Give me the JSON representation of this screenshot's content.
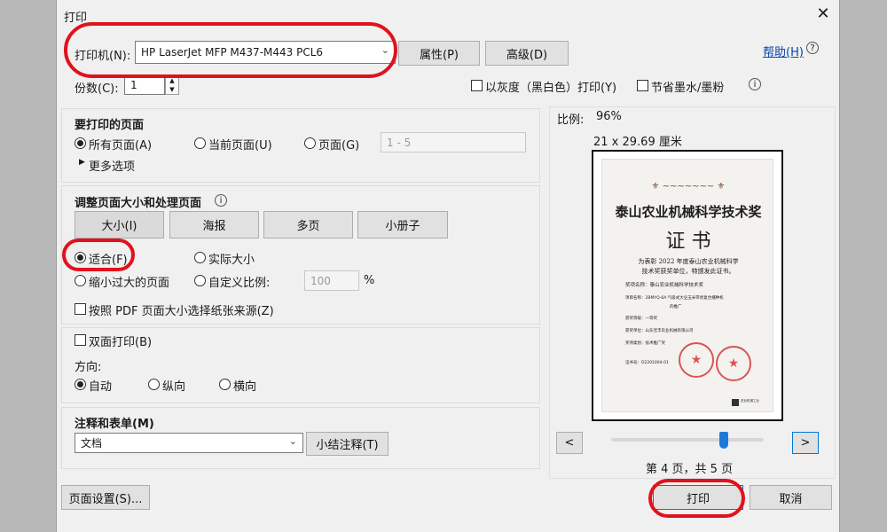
{
  "window": {
    "title": "打印"
  },
  "printer": {
    "label": "打印机(N):",
    "selected": "HP LaserJet MFP M437-M443 PCL6",
    "properties": "属性(P)",
    "advanced": "高级(D)"
  },
  "help": {
    "link": "帮助(H)"
  },
  "copies": {
    "label": "份数(C):",
    "value": "1"
  },
  "options": {
    "grayscale": "以灰度（黑白色）打印(Y)",
    "save_ink": "节省墨水/墨粉"
  },
  "pages_to_print": {
    "heading": "要打印的页面",
    "all": "所有页面(A)",
    "current": "当前页面(U)",
    "pages": "页面(G)",
    "range": "1 - 5",
    "more": "更多选项"
  },
  "sizing": {
    "heading": "调整页面大小和处理页面",
    "tabs": [
      "大小(I)",
      "海报",
      "多页",
      "小册子"
    ],
    "fit": "适合(F)",
    "actual": "实际大小",
    "shrink": "缩小过大的页面",
    "custom": "自定义比例:",
    "custom_value": "100",
    "percent": "%",
    "paper_source": "按照 PDF 页面大小选择纸张来源(Z)"
  },
  "duplex": {
    "label": "双面打印(B)"
  },
  "orientation": {
    "label": "方向:",
    "auto": "自动",
    "portrait": "纵向",
    "landscape": "横向"
  },
  "comments": {
    "heading": "注释和表单(M)",
    "selected": "文档",
    "summarize": "小结注释(T)"
  },
  "page_setup": "页面设置(S)...",
  "preview": {
    "scale_label": "比例:",
    "scale_value": "96%",
    "paper_size": "21 x 29.69 厘米",
    "page_status": "第 4 页，共 5 页",
    "prev": "<",
    "next": ">"
  },
  "certificate": {
    "title": "泰山农业机械科学技术奖",
    "subtitle": "证  书",
    "body1": "为表彰 2022 年度泰山农业机械科学",
    "body2": "技术奖获奖单位，特颁发此证书。",
    "f1": "奖项名称：泰山农业机械科学技术奖",
    "f2": "项目名称：2BMYQ-6A 气吸式大豆玉米带状复合播种机",
    "f2b": "的推广",
    "f3": "获奖等级：一等奖",
    "f4": "获奖单位：山东佳丰农业机械有限公司",
    "f5": "奖项类别：技术推广奖",
    "f6": "证书号：D2201004-01",
    "footer": "农业机械工业"
  },
  "actions": {
    "print": "打印",
    "cancel": "取消"
  }
}
